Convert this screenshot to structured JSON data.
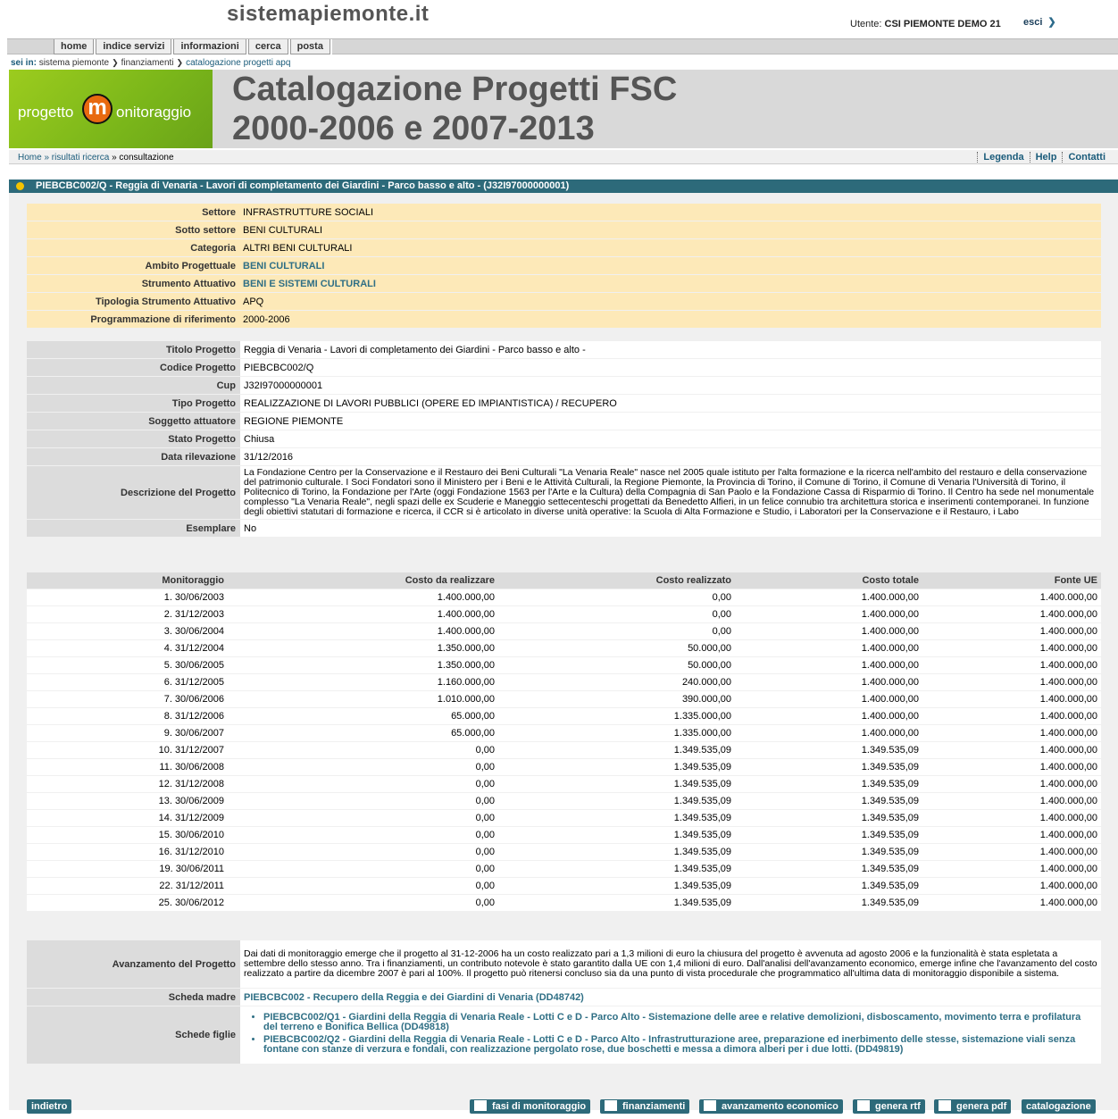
{
  "header": {
    "site_title": "sistemapiemonte.it",
    "user_label": "Utente:",
    "user_name": "CSI PIEMONTE DEMO 21",
    "logout": "esci"
  },
  "nav": {
    "items": [
      "home",
      "indice servizi",
      "informazioni",
      "cerca",
      "posta"
    ]
  },
  "sei_in": {
    "label": "sei in:",
    "items": [
      "sistema piemonte",
      "finanziamenti",
      "catalogazione progetti apq"
    ]
  },
  "banner": {
    "logo_text_left": "progetto",
    "logo_letter": "m",
    "logo_text_right": "onitoraggio",
    "title_line1": "Catalogazione Progetti FSC",
    "title_line2": "2000-2006 e 2007-2013"
  },
  "breadcrumb": {
    "home": "Home",
    "step1": "» risultati ricerca",
    "step2": "» consultazione",
    "links": [
      "Legenda",
      "Help",
      "Contatti"
    ]
  },
  "project_bar": "PIEBCBC002/Q - Reggia di Venaria - Lavori di completamento dei Giardini - Parco basso e alto - (J32I97000000001)",
  "classification": [
    {
      "label": "Settore",
      "value": "INFRASTRUTTURE SOCIALI",
      "link": false
    },
    {
      "label": "Sotto settore",
      "value": "BENI CULTURALI",
      "link": false
    },
    {
      "label": "Categoria",
      "value": "ALTRI BENI CULTURALI",
      "link": false
    },
    {
      "label": "Ambito Progettuale",
      "value": "BENI CULTURALI",
      "link": true
    },
    {
      "label": "Strumento Attuativo",
      "value": "BENI E SISTEMI CULTURALI",
      "link": true
    },
    {
      "label": "Tipologia Strumento Attuativo",
      "value": "APQ",
      "link": false
    },
    {
      "label": "Programmazione di riferimento",
      "value": "2000-2006",
      "link": false
    }
  ],
  "details": {
    "titolo_label": "Titolo Progetto",
    "titolo": "Reggia di Venaria - Lavori di completamento dei Giardini - Parco basso e alto -",
    "codice_label": "Codice Progetto",
    "codice": "PIEBCBC002/Q",
    "cup_label": "Cup",
    "cup": "J32I97000000001",
    "tipo_label": "Tipo Progetto",
    "tipo": "REALIZZAZIONE DI LAVORI PUBBLICI (OPERE ED IMPIANTISTICA) / RECUPERO",
    "soggetto_label": "Soggetto attuatore",
    "soggetto": "REGIONE PIEMONTE",
    "stato_label": "Stato Progetto",
    "stato": "Chiusa",
    "data_label": "Data rilevazione",
    "data": "31/12/2016",
    "descrizione_label": "Descrizione del Progetto",
    "descrizione": "La Fondazione Centro per la Conservazione e il Restauro dei Beni Culturali \"La Venaria Reale\" nasce nel 2005 quale istituto per l'alta formazione e la ricerca nell'ambito del restauro e della conservazione del patrimonio culturale. I Soci Fondatori sono il Ministero per i Beni e le Attività Culturali, la Regione Piemonte, la Provincia di Torino, il Comune di Torino, il Comune di Venaria l'Università di Torino, il Politecnico di Torino, la Fondazione per l'Arte (oggi Fondazione 1563 per l'Arte e la Cultura) della Compagnia di San Paolo e la Fondazione Cassa di Risparmio di Torino. Il Centro ha sede nel monumentale complesso \"La Venaria Reale\", negli spazi delle ex Scuderie e Maneggio settecenteschi progettati da Benedetto Alfieri, in un felice connubio tra architettura storica e inserimenti contemporanei. In funzione degli obiettivi statutari di formazione e ricerca, il CCR si è articolato in diverse unità operative: la Scuola di Alta Formazione e Studio, i Laboratori per la Conservazione e il Restauro, i Labo",
    "esemplare_label": "Esemplare",
    "esemplare": "No"
  },
  "monitoring": {
    "headers": [
      "Monitoraggio",
      "Costo da realizzare",
      "Costo realizzato",
      "Costo totale",
      "Fonte UE"
    ],
    "rows": [
      [
        "1. 30/06/2003",
        "1.400.000,00",
        "0,00",
        "1.400.000,00",
        "1.400.000,00"
      ],
      [
        "2. 31/12/2003",
        "1.400.000,00",
        "0,00",
        "1.400.000,00",
        "1.400.000,00"
      ],
      [
        "3. 30/06/2004",
        "1.400.000,00",
        "0,00",
        "1.400.000,00",
        "1.400.000,00"
      ],
      [
        "4. 31/12/2004",
        "1.350.000,00",
        "50.000,00",
        "1.400.000,00",
        "1.400.000,00"
      ],
      [
        "5. 30/06/2005",
        "1.350.000,00",
        "50.000,00",
        "1.400.000,00",
        "1.400.000,00"
      ],
      [
        "6. 31/12/2005",
        "1.160.000,00",
        "240.000,00",
        "1.400.000,00",
        "1.400.000,00"
      ],
      [
        "7. 30/06/2006",
        "1.010.000,00",
        "390.000,00",
        "1.400.000,00",
        "1.400.000,00"
      ],
      [
        "8. 31/12/2006",
        "65.000,00",
        "1.335.000,00",
        "1.400.000,00",
        "1.400.000,00"
      ],
      [
        "9. 30/06/2007",
        "65.000,00",
        "1.335.000,00",
        "1.400.000,00",
        "1.400.000,00"
      ],
      [
        "10. 31/12/2007",
        "0,00",
        "1.349.535,09",
        "1.349.535,09",
        "1.400.000,00"
      ],
      [
        "11. 30/06/2008",
        "0,00",
        "1.349.535,09",
        "1.349.535,09",
        "1.400.000,00"
      ],
      [
        "12. 31/12/2008",
        "0,00",
        "1.349.535,09",
        "1.349.535,09",
        "1.400.000,00"
      ],
      [
        "13. 30/06/2009",
        "0,00",
        "1.349.535,09",
        "1.349.535,09",
        "1.400.000,00"
      ],
      [
        "14. 31/12/2009",
        "0,00",
        "1.349.535,09",
        "1.349.535,09",
        "1.400.000,00"
      ],
      [
        "15. 30/06/2010",
        "0,00",
        "1.349.535,09",
        "1.349.535,09",
        "1.400.000,00"
      ],
      [
        "16. 31/12/2010",
        "0,00",
        "1.349.535,09",
        "1.349.535,09",
        "1.400.000,00"
      ],
      [
        "19. 30/06/2011",
        "0,00",
        "1.349.535,09",
        "1.349.535,09",
        "1.400.000,00"
      ],
      [
        "22. 31/12/2011",
        "0,00",
        "1.349.535,09",
        "1.349.535,09",
        "1.400.000,00"
      ],
      [
        "25. 30/06/2012",
        "0,00",
        "1.349.535,09",
        "1.349.535,09",
        "1.400.000,00"
      ]
    ]
  },
  "progress": {
    "avanzamento_label": "Avanzamento del Progetto",
    "avanzamento": "Dai dati di monitoraggio emerge che il progetto al 31-12-2006 ha un costo realizzato pari a 1,3 milioni di euro la chiusura del progetto è avvenuta ad agosto 2006 e la funzionalità è stata espletata a settembre dello stesso anno. Tra i finanziamenti, un contributo notevole è stato garantito dalla UE con 1,4 milioni di euro. Dall'analisi dell'avanzamento economico, emerge infine che l'avanzamento del costo realizzato a partire da dicembre 2007 è pari al 100%. Il progetto può ritenersi concluso sia da una punto di vista procedurale che programmatico all'ultima data di monitoraggio disponibile a sistema.",
    "madre_label": "Scheda madre",
    "madre": "PIEBCBC002 - Recupero della Reggia e dei Giardini di Venaria (DD48742)",
    "figlie_label": "Schede figlie",
    "figlie": [
      "PIEBCBC002/Q1 - Giardini della Reggia di Venaria Reale - Lotti C e D - Parco Alto - Sistemazione delle aree e relative demolizioni, disboscamento, movimento terra e profilatura del terreno e Bonifica Bellica (DD49818)",
      "PIEBCBC002/Q2 - Giardini della Reggia di Venaria Reale - Lotti C e D - Parco Alto - Infrastrutturazione aree, preparazione ed inerbimento delle stesse, sistemazione viali senza fontane con stanze di verzura e fondali, con realizzazione pergolato rose, due boschetti e messa a dimora alberi per i due lotti. (DD49819)"
    ]
  },
  "buttons": {
    "indietro": "indietro",
    "fasi": "fasi di monitoraggio",
    "finanziamenti": "finanziamenti",
    "avanzamento": "avanzamento economico",
    "rtf": "genera rtf",
    "pdf": "genera pdf",
    "catalogazione": "catalogazione"
  },
  "colors": {
    "accent": "#2d6a7a",
    "highlight_row": "#fde9b8",
    "logo_green": "#8cc21c",
    "logo_orange": "#e86a10"
  }
}
